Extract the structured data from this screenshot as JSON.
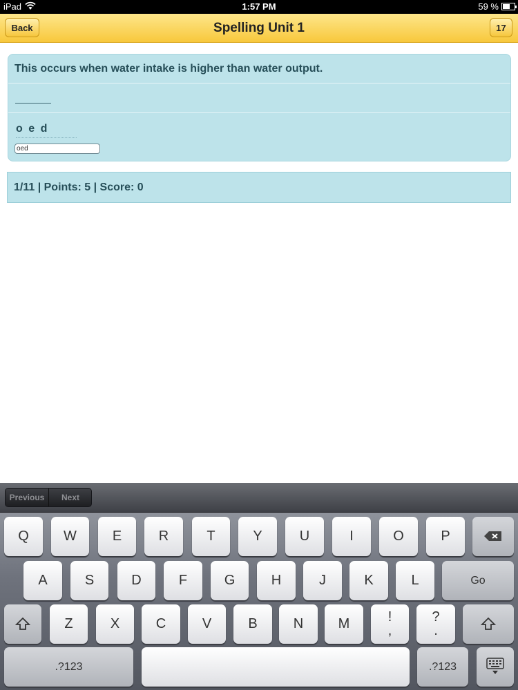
{
  "status_bar": {
    "device": "iPad",
    "time": "1:57 PM",
    "battery": "59 %"
  },
  "header": {
    "back_label": "Back",
    "title": "Spelling Unit 1",
    "counter": "17"
  },
  "question": {
    "prompt": "This occurs when water intake is higher than water output.",
    "letters": "o e d",
    "answer_value": "oed"
  },
  "status": {
    "text": "1/11 | Points: 5 | Score: 0"
  },
  "keyboard": {
    "previous_label": "Previous",
    "next_label": "Next",
    "row1": [
      "Q",
      "W",
      "E",
      "R",
      "T",
      "Y",
      "U",
      "I",
      "O",
      "P"
    ],
    "row2": [
      "A",
      "S",
      "D",
      "F",
      "G",
      "H",
      "J",
      "K",
      "L"
    ],
    "go_label": "Go",
    "row3": [
      "Z",
      "X",
      "C",
      "V",
      "B",
      "N",
      "M"
    ],
    "punct1": [
      "!",
      ","
    ],
    "punct2": [
      "?",
      "."
    ],
    "numbers_label": ".?123"
  }
}
